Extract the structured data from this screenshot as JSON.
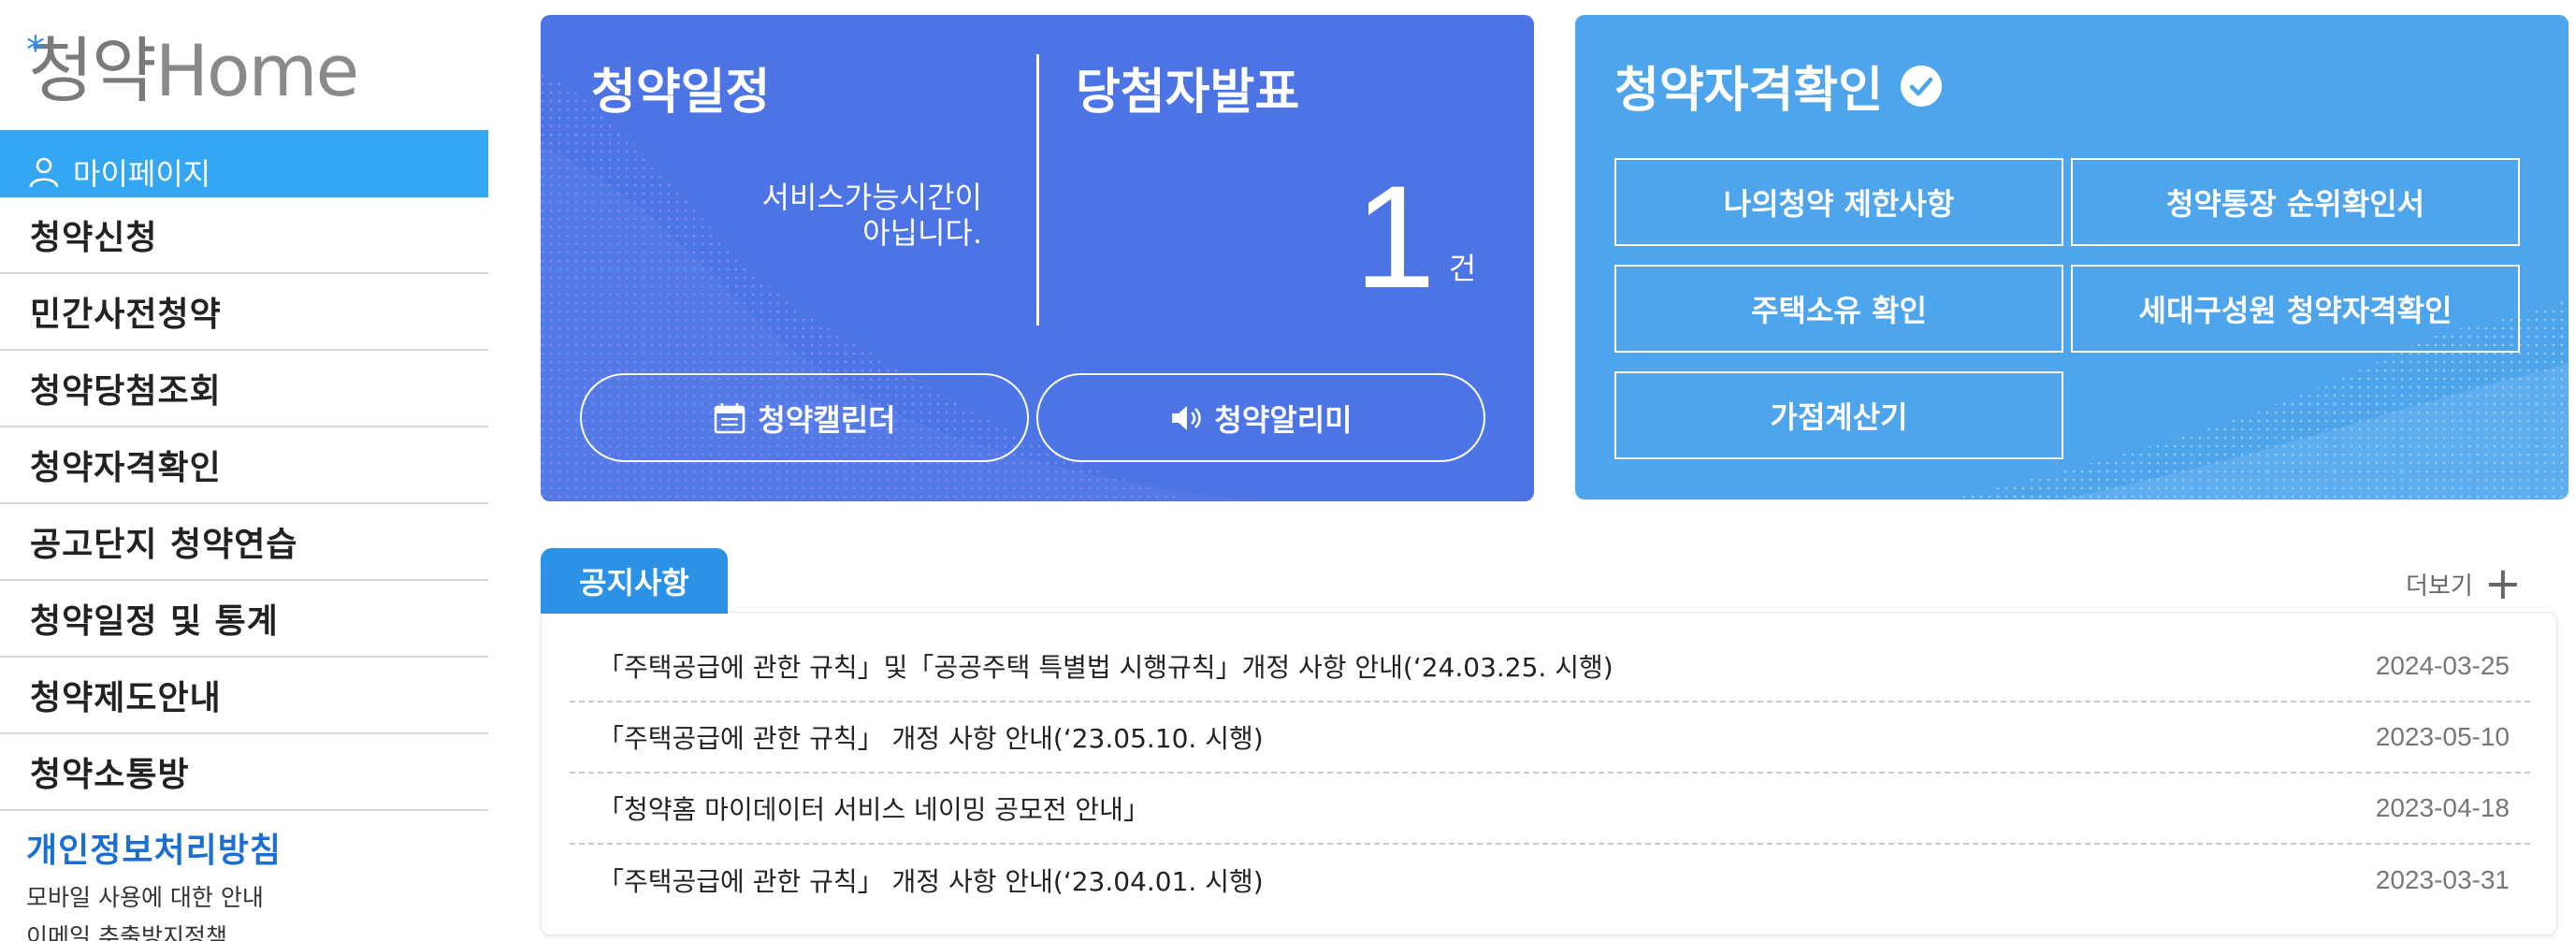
{
  "logo": {
    "text_kor": "청약",
    "text_home": "Home",
    "star": "*"
  },
  "sidebar": {
    "mypage_label": "마이페이지",
    "items": [
      {
        "label": "청약신청"
      },
      {
        "label": "민간사전청약"
      },
      {
        "label": "청약당첨조회"
      },
      {
        "label": "청약자격확인"
      },
      {
        "label": "공고단지 청약연습"
      },
      {
        "label": "청약일정 및 통계"
      },
      {
        "label": "청약제도안내"
      },
      {
        "label": "청약소통방"
      }
    ],
    "policy_title": "개인정보처리방침",
    "policy_links": [
      "모바일 사용에 대한 안내",
      "이메일 추출방지정책"
    ]
  },
  "schedule_card": {
    "title": "청약일정",
    "service_message_line1": "서비스가능시간이",
    "service_message_line2": "아닙니다.",
    "winner_title": "당첨자발표",
    "winner_count": "1",
    "winner_unit": "건",
    "calendar_button": "청약캘린더",
    "alarm_button": "청약알리미",
    "colors": {
      "background": "#4c74e5"
    }
  },
  "qualification_card": {
    "title": "청약자격확인",
    "buttons": [
      {
        "label": "나의청약 제한사항"
      },
      {
        "label": "청약통장 순위확인서"
      },
      {
        "label": "주택소유 확인"
      },
      {
        "label": "세대구성원 청약자격확인"
      },
      {
        "label": "가점계산기"
      }
    ],
    "colors": {
      "background": "#4fa5ec"
    }
  },
  "notice": {
    "tab_label": "공지사항",
    "more_label": "더보기",
    "items": [
      {
        "title": "「주택공급에 관한 규칙」및「공공주택 특별법 시행규칙」개정 사항 안내(‘24.03.25. 시행)",
        "date": "2024-03-25"
      },
      {
        "title": "「주택공급에 관한 규칙」 개정 사항 안내(‘23.05.10. 시행)",
        "date": "2023-05-10"
      },
      {
        "title": "「청약홈 마이데이터 서비스 네이밍 공모전 안내」",
        "date": "2023-04-18"
      },
      {
        "title": "「주택공급에 관한 규칙」 개정 사항 안내(‘23.04.01. 시행)",
        "date": "2023-03-31"
      }
    ]
  },
  "icons": {
    "mypage": "person-icon",
    "calendar": "calendar-icon",
    "alarm": "speaker-icon",
    "check": "check-circle-icon",
    "more": "plus-icon"
  }
}
